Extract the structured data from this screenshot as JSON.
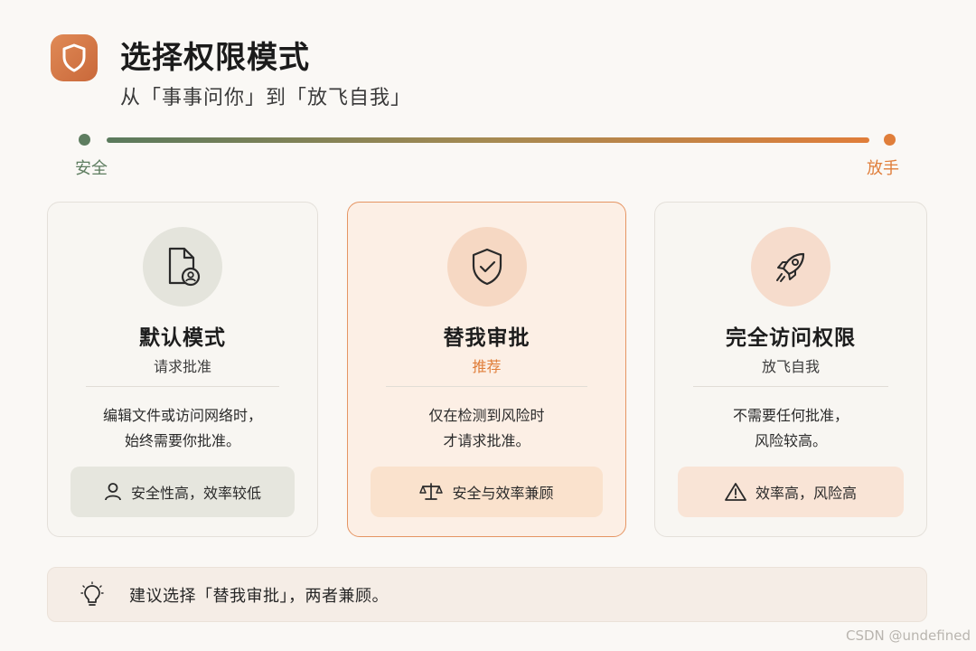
{
  "header": {
    "title": "选择权限模式",
    "subtitle": "从「事事问你」到「放飞自我」",
    "logo_icon": "shield-icon"
  },
  "slider": {
    "left_label": "安全",
    "right_label": "放手",
    "start_color": "#5e7d60",
    "end_color": "#e07e3a"
  },
  "cards": [
    {
      "icon": "document-user-icon",
      "title": "默认模式",
      "tag": "请求批准",
      "desc_line1": "编辑文件或访问网络时，",
      "desc_line2": "始终需要你批准。",
      "pill_icon": "person-icon",
      "pill_text": "安全性高，效率较低"
    },
    {
      "icon": "shield-check-icon",
      "title": "替我审批",
      "tag": "推荐",
      "desc_line1": "仅在检测到风险时",
      "desc_line2": "才请求批准。",
      "pill_icon": "balance-scale-icon",
      "pill_text": "安全与效率兼顾",
      "accent": "#e07e3a"
    },
    {
      "icon": "rocket-icon",
      "title": "完全访问权限",
      "tag": "放飞自我",
      "desc_line1": "不需要任何批准，",
      "desc_line2": "风险较高。",
      "pill_icon": "warning-icon",
      "pill_text": "效率高，风险高"
    }
  ],
  "tip": {
    "icon": "lightbulb-icon",
    "text": "建议选择「替我审批」，两者兼顾。"
  },
  "watermark": "CSDN @undefined"
}
